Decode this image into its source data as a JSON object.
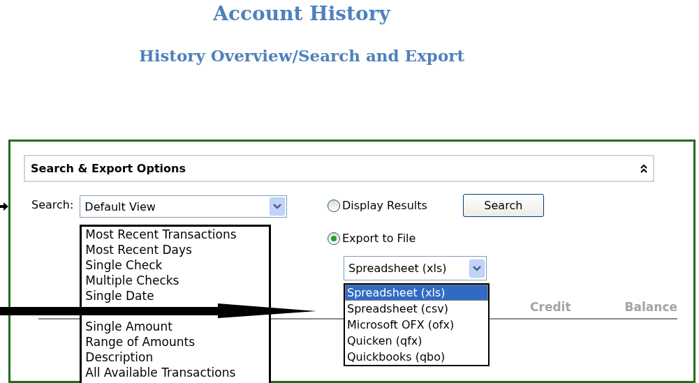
{
  "title": "Account History",
  "subtitle": "History Overview/Search and Export",
  "panel": {
    "header": "Search & Export Options",
    "expanded": true
  },
  "search": {
    "label": "Search:",
    "value": "Default View",
    "options": [
      {
        "kind": "item",
        "text": "Most Recent Transactions"
      },
      {
        "kind": "item",
        "text": "Most Recent Days"
      },
      {
        "kind": "item",
        "text": "Single Check"
      },
      {
        "kind": "item",
        "text": "Multiple Checks"
      },
      {
        "kind": "item",
        "text": "Single Date"
      },
      {
        "kind": "covered"
      },
      {
        "kind": "item",
        "text": "Single Amount"
      },
      {
        "kind": "item",
        "text": "Range of Amounts"
      },
      {
        "kind": "item",
        "text": "Description"
      },
      {
        "kind": "item",
        "text": "All Available Transactions"
      }
    ]
  },
  "output": [
    {
      "label": "Display Results",
      "selected": false
    },
    {
      "label": "Export to File",
      "selected": true
    }
  ],
  "search_button": "Search",
  "format": {
    "value": "Spreadsheet (xls)",
    "options": [
      {
        "text": "Spreadsheet (xls)",
        "selected": true
      },
      {
        "text": "Spreadsheet (csv)",
        "selected": false
      },
      {
        "text": "Microsoft OFX (ofx)",
        "selected": false
      },
      {
        "text": "Quicken (qfx)",
        "selected": false
      },
      {
        "text": "Quickbooks (qbo)",
        "selected": false
      }
    ]
  },
  "columns": [
    "Credit",
    "Balance"
  ]
}
